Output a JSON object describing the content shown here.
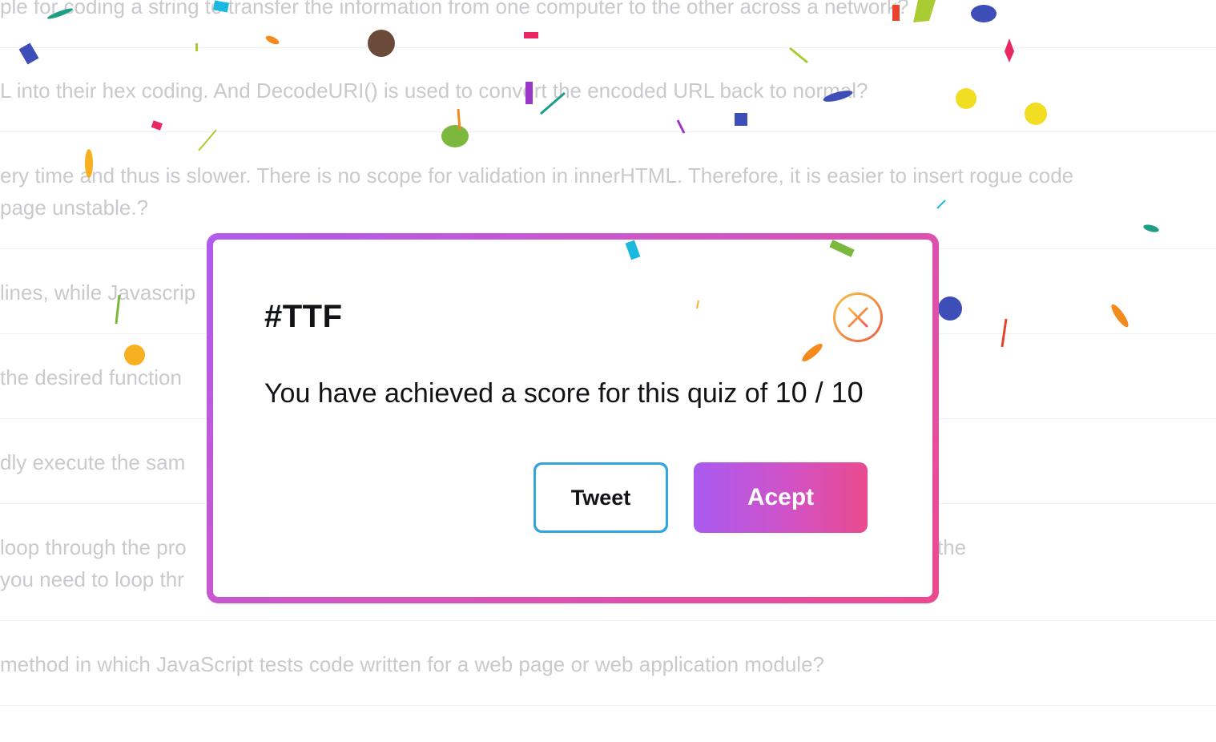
{
  "background": {
    "rows": [
      {
        "lines": [
          "ple for coding a string to transfer the information from one computer to the other across a network?"
        ]
      },
      {
        "lines": [
          "L into their hex coding. And DecodeURI() is used to convert the encoded URL back to normal?"
        ]
      },
      {
        "lines": [
          "ery time and thus is slower. There is no scope for validation in innerHTML. Therefore, it is easier to insert rogue code",
          " page unstable.?"
        ]
      },
      {
        "lines": [
          "lines, while Javascrip"
        ]
      },
      {
        "lines": [
          "the desired function"
        ]
      },
      {
        "lines": [
          "dly execute the sam                                                                                              ition is true.?"
        ]
      },
      {
        "lines": [
          "loop through the pro                                                                                              ject’s name should be the",
          "you need to loop thr"
        ]
      },
      {
        "lines": [
          "method in which JavaScript tests code written for a web page or web application module?"
        ]
      }
    ]
  },
  "modal": {
    "title": "#TTF",
    "score_prefix": "You have achieved a score for this quiz of ",
    "score_value": "10 / 10",
    "close_icon": "close-icon",
    "tweet_label": "Tweet",
    "accept_label": "Acept",
    "colors": {
      "border_start": "#b05cf0",
      "border_end": "#ec4a8f",
      "close_start": "#f6c447",
      "close_end": "#ee5a4a",
      "tweet_border": "#38a3d6"
    }
  },
  "confetti_colors": [
    "#1e9e85",
    "#1bb8e0",
    "#f28a1d",
    "#6b4a3a",
    "#e8285e",
    "#aacc33",
    "#f1dd22",
    "#3d4eb8",
    "#7bb83d",
    "#9b36c9",
    "#f6b020",
    "#e8442d"
  ]
}
